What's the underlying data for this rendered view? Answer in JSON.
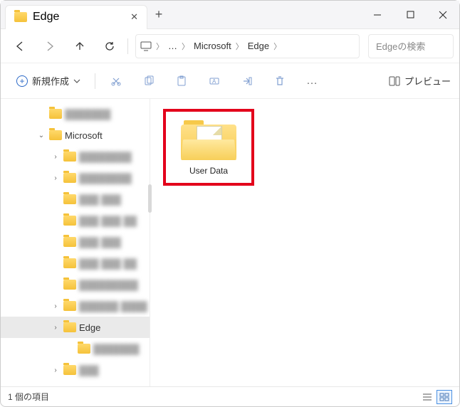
{
  "window": {
    "tab_title": "Edge",
    "search_placeholder": "Edgeの検索"
  },
  "breadcrumb": {
    "ellipsis": "…",
    "items": [
      "Microsoft",
      "Edge"
    ]
  },
  "toolbar": {
    "new_label": "新規作成",
    "preview_label": "プレビュー"
  },
  "tree": {
    "items": [
      {
        "level": 1,
        "chev": "",
        "label": "███████",
        "blur": true
      },
      {
        "level": 1,
        "chev": "v",
        "label": "Microsoft",
        "blur": false
      },
      {
        "level": 2,
        "chev": ">",
        "label": "████████",
        "blur": true
      },
      {
        "level": 2,
        "chev": ">",
        "label": "████████",
        "blur": true
      },
      {
        "level": 2,
        "chev": "",
        "label": "███ ███",
        "blur": true
      },
      {
        "level": 2,
        "chev": "",
        "label": "███ ███ ██",
        "blur": true
      },
      {
        "level": 2,
        "chev": "",
        "label": "███ ███",
        "blur": true
      },
      {
        "level": 2,
        "chev": "",
        "label": "███ ███ ██",
        "blur": true
      },
      {
        "level": 2,
        "chev": "",
        "label": "█████████",
        "blur": true
      },
      {
        "level": 2,
        "chev": ">",
        "label": "██████ ████",
        "blur": true
      },
      {
        "level": 2,
        "chev": ">",
        "label": "Edge",
        "blur": false,
        "selected": true
      },
      {
        "level": 3,
        "chev": "",
        "label": "███████",
        "blur": true
      },
      {
        "level": 2,
        "chev": ">",
        "label": "███",
        "blur": true
      }
    ]
  },
  "content": {
    "items": [
      {
        "label": "User Data",
        "highlighted": true
      }
    ]
  },
  "statusbar": {
    "count_text": "1 個の項目"
  }
}
